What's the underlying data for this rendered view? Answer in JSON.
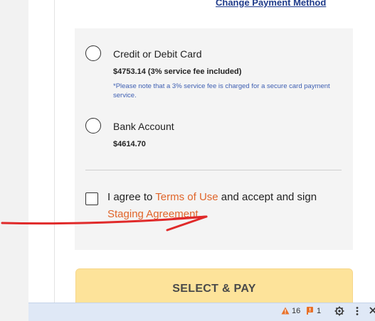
{
  "header": {
    "change_payment_link": "Change Payment Method"
  },
  "payment_options": [
    {
      "label": "Credit or Debit Card",
      "amount": "$4753.14 (3% service fee included)",
      "note": "*Please note that a 3% service fee is charged for a secure card payment service."
    },
    {
      "label": "Bank Account",
      "amount": "$4614.70"
    }
  ],
  "agreement": {
    "text_1": "I agree to ",
    "terms_link": "Terms of Use",
    "text_2": " and accept and sign ",
    "staging_link": "Staging Agreement",
    "text_3": "."
  },
  "select_pay_label": "SELECT & PAY",
  "devtools": {
    "warnings_count": "16",
    "issues_count": "1",
    "warning_icon": "warning-icon",
    "issue_icon": "flag-icon",
    "settings_icon": "gear-icon",
    "more_icon": "kebab-icon",
    "close_icon": "close-icon"
  },
  "colors": {
    "link_orange": "#e0652a",
    "note_blue": "#3e5fb2",
    "button_yellow": "#fde39a",
    "annotation_red": "#e02a2a"
  }
}
